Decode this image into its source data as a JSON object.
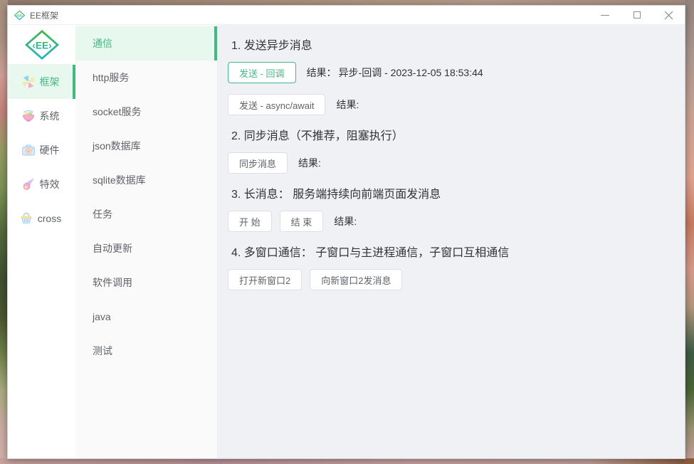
{
  "window": {
    "title": "EE框架",
    "controls": {
      "minimize": "minimize-icon",
      "maximize": "maximize-icon",
      "close": "close-icon"
    }
  },
  "sidebar": {
    "logo": "ee-diamond-logo",
    "logo_text": "EE",
    "items": [
      {
        "label": "框架",
        "icon": "pinwheel-icon",
        "active": true
      },
      {
        "label": "系统",
        "icon": "bowl-icon",
        "active": false
      },
      {
        "label": "硬件",
        "icon": "camera-icon",
        "active": false
      },
      {
        "label": "特效",
        "icon": "comet-icon",
        "active": false
      },
      {
        "label": "cross",
        "icon": "basket-icon",
        "active": false
      }
    ]
  },
  "menu": {
    "items": [
      {
        "label": "通信",
        "active": true
      },
      {
        "label": "http服务",
        "active": false
      },
      {
        "label": "socket服务",
        "active": false
      },
      {
        "label": "json数据库",
        "active": false
      },
      {
        "label": "sqlite数据库",
        "active": false
      },
      {
        "label": "任务",
        "active": false
      },
      {
        "label": "自动更新",
        "active": false
      },
      {
        "label": "软件调用",
        "active": false
      },
      {
        "label": "java",
        "active": false
      },
      {
        "label": "测试",
        "active": false
      }
    ]
  },
  "content": {
    "sections": [
      {
        "heading": "1. 发送异步消息",
        "rows": [
          {
            "buttons": [
              {
                "label": "发送 - 回调",
                "style": "green"
              }
            ],
            "result_label": "结果：",
            "result_value": "异步-回调 - 2023-12-05 18:53:44"
          },
          {
            "buttons": [
              {
                "label": "发送 - async/await",
                "style": "default"
              }
            ],
            "result_label": "结果:",
            "result_value": ""
          }
        ]
      },
      {
        "heading": "2. 同步消息（不推荐，阻塞执行）",
        "rows": [
          {
            "buttons": [
              {
                "label": "同步消息",
                "style": "default"
              }
            ],
            "result_label": "结果:",
            "result_value": ""
          }
        ]
      },
      {
        "heading": "3. 长消息： 服务端持续向前端页面发消息",
        "rows": [
          {
            "buttons": [
              {
                "label": "开 始",
                "style": "default"
              },
              {
                "label": "结 束",
                "style": "default"
              }
            ],
            "result_label": "结果:",
            "result_value": ""
          }
        ]
      },
      {
        "heading": "4. 多窗口通信： 子窗口与主进程通信，子窗口互相通信",
        "rows": [
          {
            "buttons": [
              {
                "label": "打开新窗口2",
                "style": "default"
              },
              {
                "label": "向新窗口2发消息",
                "style": "default"
              }
            ],
            "result_label": "",
            "result_value": ""
          }
        ]
      }
    ]
  },
  "colors": {
    "accent_green": "#42b983",
    "accent_green_bg": "#e7f9ee",
    "content_bg": "#eff1f4",
    "menu_bg": "#fafafa"
  }
}
